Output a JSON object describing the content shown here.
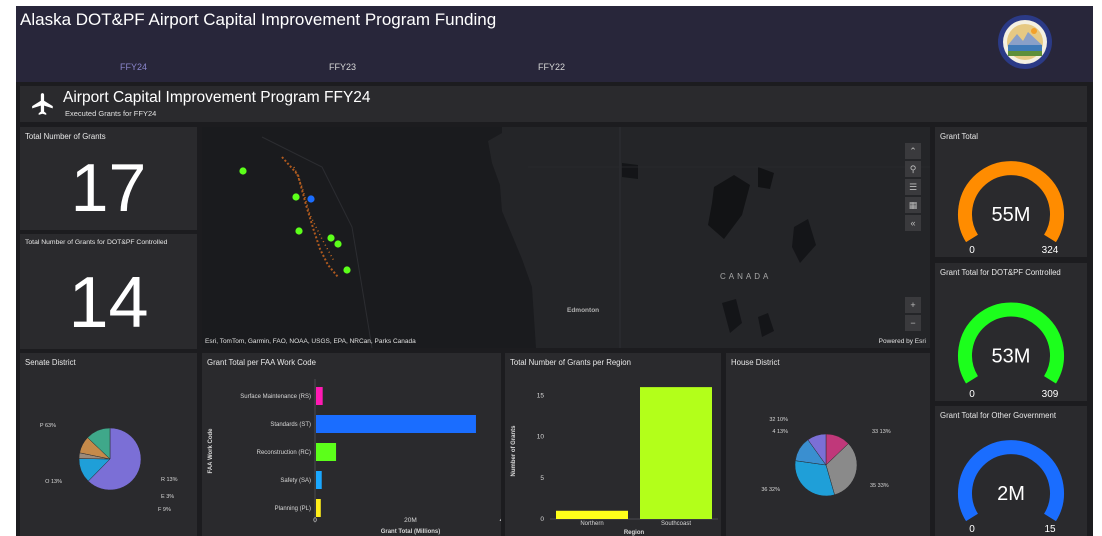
{
  "header": {
    "title": "Alaska DOT&PF Airport Capital Improvement Program Funding",
    "tabs": [
      {
        "label": "FFY24",
        "active": true
      },
      {
        "label": "FFY23",
        "active": false
      },
      {
        "label": "FFY22",
        "active": false
      }
    ]
  },
  "banner": {
    "title": "Airport Capital Improvement Program FFY24",
    "subtitle": "Executed Grants for FFY24",
    "icon": "airplane-icon"
  },
  "kpis": {
    "total_grants": {
      "title": "Total Number of Grants",
      "value": "17"
    },
    "dotpf_grants": {
      "title": "Total Number of Grants for DOT&PF Controlled",
      "value": "14"
    }
  },
  "gauges": [
    {
      "title": "Grant Total",
      "value_label": "55M",
      "min_label": "0",
      "max_label": "324",
      "fraction": 0.17,
      "color": "#ff8c00"
    },
    {
      "title": "Grant Total for DOT&PF Controlled",
      "value_label": "53M",
      "min_label": "0",
      "max_label": "309",
      "fraction": 0.17,
      "color": "#1cff1c"
    },
    {
      "title": "Grant Total for Other Government",
      "value_label": "2M",
      "min_label": "0",
      "max_label": "15",
      "fraction": 0.13,
      "color": "#1a6dff"
    }
  ],
  "map": {
    "attribution": "Esri, TomTom, Garmin, FAO, NOAA, USGS, EPA, NRCan, Parks Canada",
    "powered_by": "Powered by Esri",
    "labels": {
      "country": "CANADA",
      "city": "Edmonton"
    },
    "controls": [
      "collapse-icon",
      "search-icon",
      "layers-list-icon",
      "basemap-icon",
      "expand-icon",
      "zoom-in-icon",
      "zoom-out-icon"
    ]
  },
  "senate_district": {
    "title": "Senate District",
    "chart_data": {
      "type": "pie",
      "slices": [
        {
          "label": "P 63%",
          "value": 63,
          "color": "#7b6fd6"
        },
        {
          "label": "R 13%",
          "value": 13,
          "color": "#1f9fd8"
        },
        {
          "label": "E 3%",
          "value": 3,
          "color": "#9b8a7a"
        },
        {
          "label": "F 9%",
          "value": 9,
          "color": "#c58a4a"
        },
        {
          "label": "O 13%",
          "value": 13,
          "color": "#3fa88a"
        }
      ]
    }
  },
  "work_code": {
    "title": "Grant Total per FAA Work Code",
    "chart_data": {
      "type": "bar",
      "orientation": "horizontal",
      "categories": [
        "Surface Maintenance (RS)",
        "Standards (ST)",
        "Reconstruction (RC)",
        "Safety (SA)",
        "Planning (PL)"
      ],
      "values": [
        1.4,
        33.5,
        4.2,
        1.2,
        1.0
      ],
      "colors": [
        "#ff1ab3",
        "#1a6dff",
        "#5cff1a",
        "#1aa7ff",
        "#ffee1a"
      ],
      "xlabel": "Grant Total (Millions)",
      "ylabel": "FAA Work Code",
      "xticks": [
        "0",
        "20M",
        "40M"
      ],
      "xlim": [
        0,
        40
      ]
    }
  },
  "region": {
    "title": "Total Number of Grants per Region",
    "chart_data": {
      "type": "bar",
      "categories": [
        "Northern",
        "Southcoast"
      ],
      "values": [
        1,
        16
      ],
      "colors": [
        "#ffff1a",
        "#b3ff1a"
      ],
      "xlabel": "Region",
      "ylabel": "Number of Grants",
      "yticks": [
        "0",
        "5",
        "10",
        "15"
      ],
      "ylim": [
        0,
        16.5
      ]
    }
  },
  "house_district": {
    "title": "House District",
    "chart_data": {
      "type": "pie",
      "slices": [
        {
          "label": "33 13%",
          "value": 13,
          "color": "#c0387a"
        },
        {
          "label": "35 33%",
          "value": 33,
          "color": "#8a8a8a"
        },
        {
          "label": "36 32%",
          "value": 32,
          "color": "#1f9fd8"
        },
        {
          "label": "4 13%",
          "value": 13,
          "color": "#3a8fd0"
        },
        {
          "label": "32 10%",
          "value": 10,
          "color": "#7b6fd6"
        }
      ]
    }
  }
}
